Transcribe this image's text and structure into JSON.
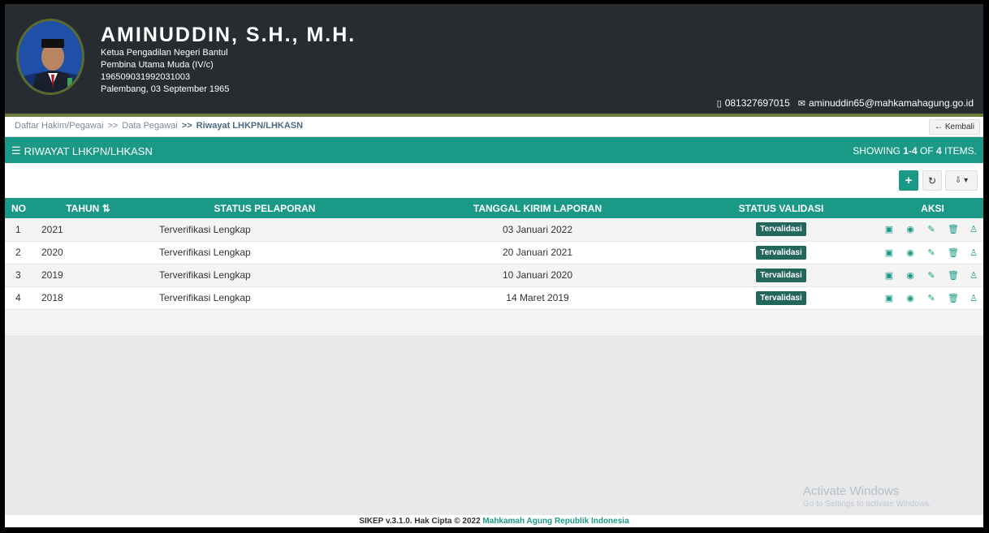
{
  "profile": {
    "name": "AMINUDDIN, S.H., M.H.",
    "position": "Ketua Pengadilan Negeri Bantul",
    "rank": "Pembina Utama Muda (IV/c)",
    "nip": "196509031992031003",
    "birth": "Palembang, 03 September 1965",
    "phone": "081327697015",
    "email": "aminuddin65@mahkamahagung.go.id"
  },
  "breadcrumb": {
    "items": [
      "Daftar Hakim/Pegawai",
      "Data Pegawai",
      "Riwayat LHKPN/LHKASN"
    ],
    "separator": ">>",
    "back_label": "Kembali"
  },
  "panel": {
    "title": "RIWAYAT LHKPN/LHKASN",
    "summary_prefix": "SHOWING ",
    "summary_range": "1-4",
    "summary_mid": " OF ",
    "summary_total": "4",
    "summary_suffix": " ITEMS."
  },
  "toolbar": {
    "add_icon": "plus-icon",
    "refresh_icon": "refresh-icon",
    "export_icon": "export-icon"
  },
  "table": {
    "columns": [
      "NO",
      "TAHUN",
      "STATUS PELAPORAN",
      "TANGGAL KIRIM LAPORAN",
      "STATUS VALIDASI",
      "AKSI"
    ],
    "rows": [
      {
        "no": "1",
        "tahun": "2021",
        "status": "Terverifikasi Lengkap",
        "tanggal": "03 Januari 2022",
        "validasi": "Tervalidasi"
      },
      {
        "no": "2",
        "tahun": "2020",
        "status": "Terverifikasi Lengkap",
        "tanggal": "20 Januari 2021",
        "validasi": "Tervalidasi"
      },
      {
        "no": "3",
        "tahun": "2019",
        "status": "Terverifikasi Lengkap",
        "tanggal": "10 Januari 2020",
        "validasi": "Tervalidasi"
      },
      {
        "no": "4",
        "tahun": "2018",
        "status": "Terverifikasi Lengkap",
        "tanggal": "14 Maret 2019",
        "validasi": "Tervalidasi"
      }
    ]
  },
  "watermark": {
    "line1": "Activate Windows",
    "line2": "Go to Settings to activate Windows."
  },
  "footer": {
    "text": "SIKEP v.3.1.0. Hak Cipta © 2022 ",
    "link": "Mahkamah Agung Republik Indonesia"
  },
  "colors": {
    "accent": "#1a9a86",
    "header_bg": "#262c30",
    "badge": "#22665c"
  }
}
